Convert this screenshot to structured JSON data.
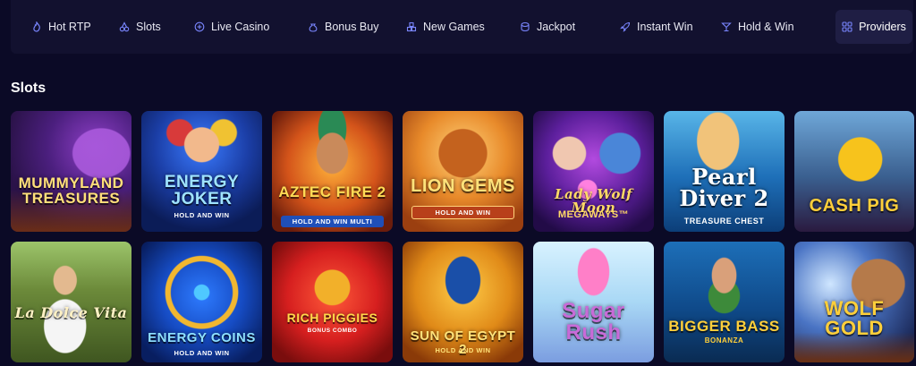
{
  "nav": {
    "items": [
      {
        "label": "Hot RTP",
        "icon": "flame-icon"
      },
      {
        "label": "Slots",
        "icon": "cherries-icon"
      },
      {
        "label": "Live Casino",
        "icon": "live-dealer-icon"
      },
      {
        "label": "Bonus Buy",
        "icon": "money-bag-icon"
      },
      {
        "label": "New Games",
        "icon": "boxes-icon"
      },
      {
        "label": "Jackpot",
        "icon": "coins-icon"
      },
      {
        "label": "Instant Win",
        "icon": "rocket-icon"
      },
      {
        "label": "Hold & Win",
        "icon": "cocktail-icon"
      }
    ],
    "providers": {
      "label": "Providers",
      "icon": "grid-icon"
    }
  },
  "section": {
    "title": "Slots"
  },
  "games": [
    {
      "title": "MUMMYLAND TREASURES",
      "subtitle": ""
    },
    {
      "title": "ENERGY JOKER",
      "subtitle": "HOLD AND WIN"
    },
    {
      "title": "AZTEC FIRE 2",
      "subtitle": "HOLD AND WIN MULTI"
    },
    {
      "title": "LION GEMS",
      "subtitle": "HOLD AND WIN"
    },
    {
      "title": "Lady Wolf Moon",
      "subtitle": "MEGAWAYS™"
    },
    {
      "title": "Pearl Diver 2",
      "subtitle": "TREASURE CHEST"
    },
    {
      "title": "CASH PIG",
      "subtitle": ""
    },
    {
      "title": "La Dolce Vita",
      "subtitle": ""
    },
    {
      "title": "ENERGY COINS",
      "subtitle": "HOLD AND WIN"
    },
    {
      "title": "RICH PIGGIES",
      "subtitle": "BONUS COMBO"
    },
    {
      "title": "SUN OF EGYPT 2",
      "subtitle": "HOLD AND WIN"
    },
    {
      "title": "Sugar Rush",
      "subtitle": ""
    },
    {
      "title": "BIGGER BASS",
      "subtitle": "BONANZA"
    },
    {
      "title": "WOLF GOLD",
      "subtitle": ""
    }
  ]
}
